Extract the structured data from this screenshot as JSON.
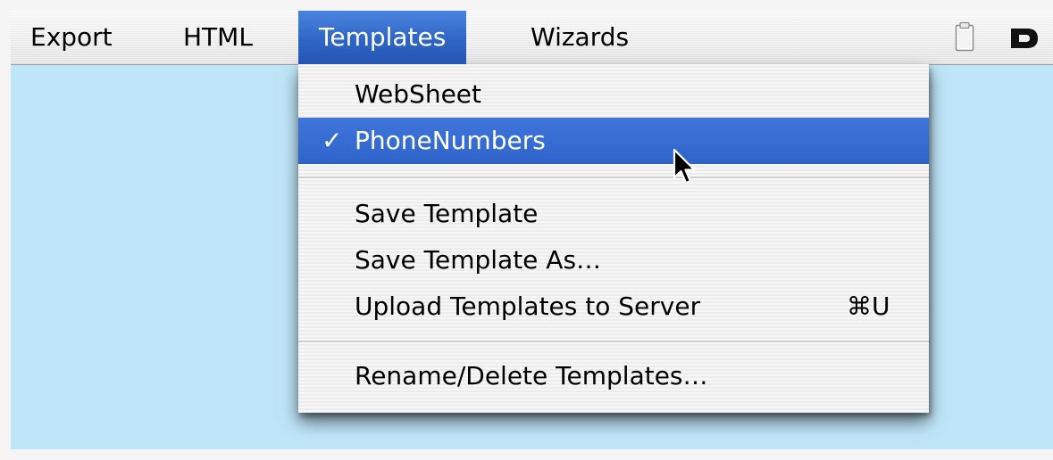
{
  "menubar": {
    "menus": [
      {
        "label": "Export"
      },
      {
        "label": "HTML"
      },
      {
        "label": "Templates"
      },
      {
        "label": "Wizards"
      }
    ],
    "tray_icons": [
      "clipboard-icon",
      "app-d-icon"
    ]
  },
  "dropdown": {
    "items": [
      {
        "label": "WebSheet",
        "checked": false,
        "highlighted": false
      },
      {
        "label": "PhoneNumbers",
        "checked": true,
        "highlighted": true,
        "check_mark": "✓"
      },
      {
        "label": "Save Template"
      },
      {
        "label": "Save Template As…"
      },
      {
        "label": "Upload Templates to Server",
        "shortcut": "⌘U"
      },
      {
        "label": "Rename/Delete Templates…"
      }
    ]
  },
  "colors": {
    "desktop": "#bfe6f8",
    "highlight": "#3369d1",
    "menu_background": "#f2f2f2"
  },
  "cursor": "arrow-cursor-icon"
}
